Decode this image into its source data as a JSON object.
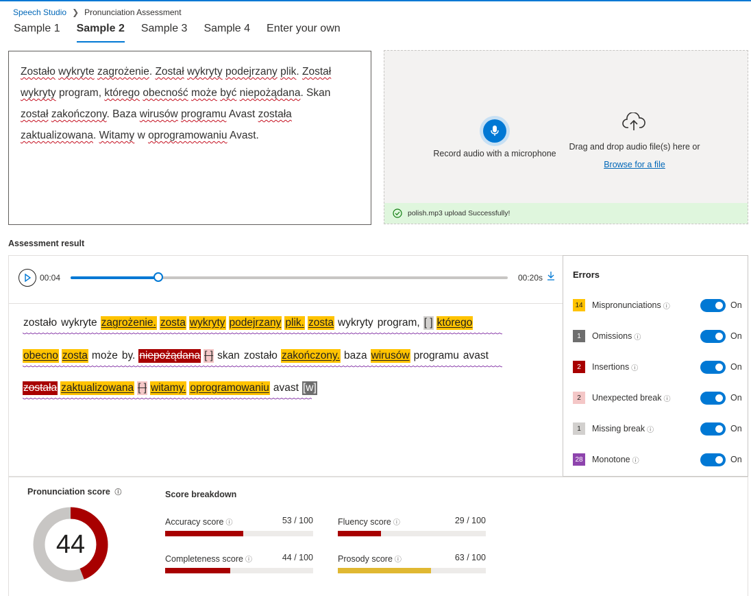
{
  "breadcrumb": {
    "root": "Speech Studio",
    "current": "Pronunciation Assessment"
  },
  "tabs": [
    "Sample 1",
    "Sample 2",
    "Sample 3",
    "Sample 4",
    "Enter your own"
  ],
  "active_tab": "Sample 2",
  "reference_text": {
    "lines": [
      [
        {
          "t": "Zostało",
          "sq": true
        },
        {
          "t": " "
        },
        {
          "t": "wykryte",
          "sq": true
        },
        {
          "t": " "
        },
        {
          "t": "zagrożenie",
          "sq": true
        },
        {
          "t": ". "
        },
        {
          "t": "Został",
          "sq": true
        },
        {
          "t": " "
        },
        {
          "t": "wykryty",
          "sq": true
        },
        {
          "t": " "
        },
        {
          "t": "podejrzany",
          "sq": true
        },
        {
          "t": " "
        },
        {
          "t": "plik",
          "sq": true
        },
        {
          "t": ". "
        },
        {
          "t": "Został",
          "sq": true
        }
      ],
      [
        {
          "t": "wykryty",
          "sq": true
        },
        {
          "t": " program, "
        },
        {
          "t": "którego",
          "sq": true
        },
        {
          "t": " "
        },
        {
          "t": "obecność",
          "sq": true
        },
        {
          "t": " "
        },
        {
          "t": "może",
          "sq": true
        },
        {
          "t": " "
        },
        {
          "t": "być",
          "sq": true
        },
        {
          "t": " "
        },
        {
          "t": "niepożądana",
          "sq": true
        },
        {
          "t": ". Skan"
        }
      ],
      [
        {
          "t": "został",
          "sq": true
        },
        {
          "t": " "
        },
        {
          "t": "zakończony",
          "sq": true
        },
        {
          "t": ". Baza "
        },
        {
          "t": "wirusów",
          "sq": true
        },
        {
          "t": " "
        },
        {
          "t": "programu",
          "sq": true
        },
        {
          "t": " Avast "
        },
        {
          "t": "została",
          "sq": true
        }
      ],
      [
        {
          "t": "zaktualizowana",
          "sq": true
        },
        {
          "t": ". "
        },
        {
          "t": "Witamy",
          "sq": true
        },
        {
          "t": " w "
        },
        {
          "t": "oprogramowaniu",
          "sq": true
        },
        {
          "t": " Avast."
        }
      ]
    ]
  },
  "upload": {
    "record_label": "Record audio with a microphone",
    "drag_label": "Drag and drop audio file(s) here or",
    "browse_label": "Browse for a file",
    "status": "polish.mp3 upload Successfully!"
  },
  "assessment_title": "Assessment result",
  "player": {
    "current": "00:04",
    "duration": "00:20s",
    "progress": 0.2
  },
  "result_lines": [
    [
      {
        "t": "zostało",
        "k": "n"
      },
      {
        "t": "wykryte",
        "k": "n"
      },
      {
        "t": "zagrożenie.",
        "k": "mis"
      },
      {
        "t": "zosta",
        "k": "mis"
      },
      {
        "t": "wykryty",
        "k": "mis"
      },
      {
        "t": "podejrzany",
        "k": "mis"
      },
      {
        "t": "plik.",
        "k": "mis"
      },
      {
        "t": "zosta",
        "k": "mis"
      },
      {
        "t": "wykryty",
        "k": "n"
      },
      {
        "t": "program,",
        "k": "n"
      },
      {
        "t": "[ ]",
        "k": "mb"
      },
      {
        "t": "którego",
        "k": "mis"
      }
    ],
    [
      {
        "t": "obecno",
        "k": "mis"
      },
      {
        "t": "zosta",
        "k": "mis"
      },
      {
        "t": "może",
        "k": "n"
      },
      {
        "t": "by.",
        "k": "n"
      },
      {
        "t": "niepożądana",
        "k": "ins"
      },
      {
        "t": "[ ]",
        "k": "ub"
      },
      {
        "t": "skan",
        "k": "n"
      },
      {
        "t": "zostało",
        "k": "n"
      },
      {
        "t": "zakończony.",
        "k": "mis"
      },
      {
        "t": "baza",
        "k": "n"
      },
      {
        "t": "wirusów",
        "k": "mis"
      },
      {
        "t": "programu",
        "k": "n"
      },
      {
        "t": "avast",
        "k": "n"
      }
    ],
    [
      {
        "t": "została",
        "k": "ins"
      },
      {
        "t": "zaktualizowana",
        "k": "mis"
      },
      {
        "t": "[ ]",
        "k": "ub"
      },
      {
        "t": "witamy.",
        "k": "mis"
      },
      {
        "t": "oprogramowaniu",
        "k": "mis"
      },
      {
        "t": "avast",
        "k": "n"
      },
      {
        "t": "[w]",
        "k": "om"
      }
    ]
  ],
  "errors": {
    "title": "Errors",
    "items": [
      {
        "count": "14",
        "label": "Mispronunciations",
        "color": "#ffc300",
        "text_color": "#201f1e",
        "state": "On"
      },
      {
        "count": "1",
        "label": "Omissions",
        "color": "#6e6e6e",
        "text_color": "#ffffff",
        "state": "On"
      },
      {
        "count": "2",
        "label": "Insertions",
        "color": "#a80000",
        "text_color": "#ffffff",
        "state": "On"
      },
      {
        "count": "2",
        "label": "Unexpected break",
        "color": "#f4c7c7",
        "text_color": "#201f1e",
        "state": "On"
      },
      {
        "count": "1",
        "label": "Missing break",
        "color": "#d2d0ce",
        "text_color": "#201f1e",
        "state": "On"
      },
      {
        "count": "28",
        "label": "Monotone",
        "color": "#8e44ad",
        "text_color": "#ffffff",
        "state": "On"
      }
    ]
  },
  "pronunciation_score": {
    "title": "Pronunciation score",
    "value": 44
  },
  "score_breakdown": {
    "title": "Score breakdown",
    "metrics": [
      {
        "label": "Accuracy score",
        "value": "53 / 100",
        "fraction": 0.53,
        "color": "#a80000"
      },
      {
        "label": "Fluency score",
        "value": "29 / 100",
        "fraction": 0.29,
        "color": "#a80000"
      },
      {
        "label": "Completeness score",
        "value": "44 / 100",
        "fraction": 0.44,
        "color": "#a80000"
      },
      {
        "label": "Prosody score",
        "value": "63 / 100",
        "fraction": 0.63,
        "color": "#e0b832"
      }
    ]
  }
}
